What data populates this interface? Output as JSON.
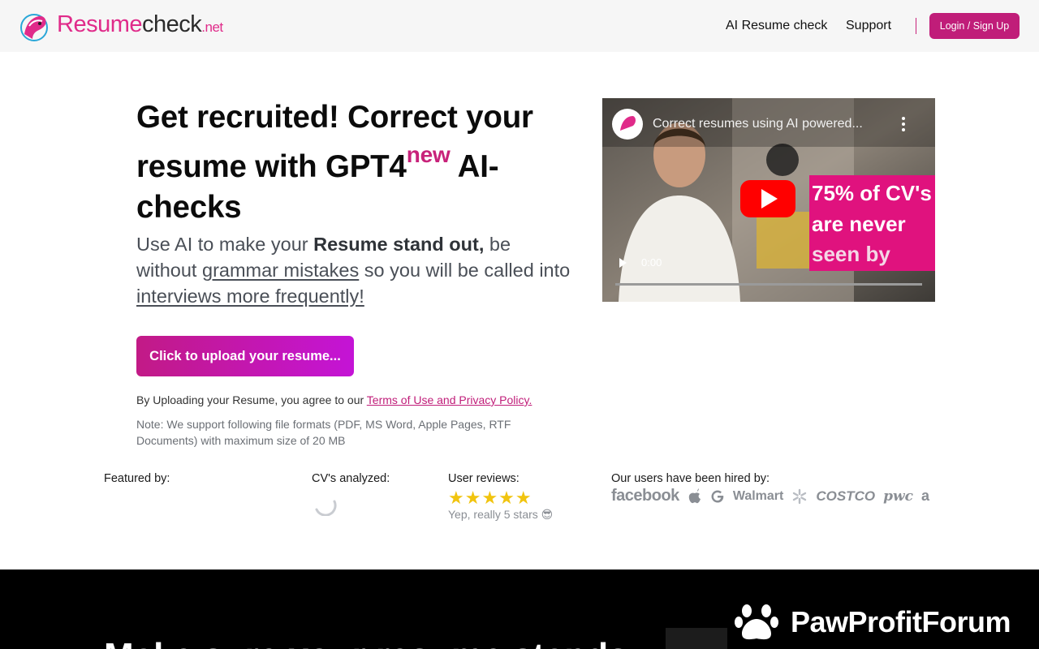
{
  "header": {
    "logo": {
      "part1": "Resume",
      "part2": "check",
      "part3": ".net"
    },
    "nav": {
      "ai_resume_check": "AI Resume check",
      "support": "Support"
    },
    "login_label": "Login / Sign Up"
  },
  "hero": {
    "headline_part1": "Get recruited! Correct your resume with GPT4",
    "headline_sup": "new",
    "headline_part2": " AI-checks",
    "sub_1": "Use AI to make your ",
    "sub_bold": "Resume stand out,",
    "sub_2": " be without ",
    "sub_link1": "grammar mistakes",
    "sub_3": " so you will be called into ",
    "sub_link2": "interviews more frequently!",
    "upload_label": "Click to upload your resume...",
    "agree_text": "By Uploading your Resume, you agree to our ",
    "agree_link": "Terms of Use and Privacy Policy.",
    "note": "Note: We support following file formats (PDF, MS Word, Apple Pages, RTF Documents) with maximum size of 20 MB"
  },
  "video": {
    "title": "Correct resumes using AI powered...",
    "time": "0:00",
    "overlay_line1": "75% of CV's",
    "overlay_line2": "are never",
    "overlay_line3": "seen by"
  },
  "stats": {
    "featured_label": "Featured by:",
    "analyzed_label": "CV's analyzed:",
    "reviews_label": "User reviews:",
    "stars": "★★★★★",
    "rating": 5,
    "reviews_text": "Yep, really 5 stars 😎",
    "hired_label": "Our users have been hired by:",
    "brands": [
      "facebook",
      "Walmart",
      "COSTCO",
      "pwc",
      "a"
    ]
  },
  "section2": {
    "title": "Make sure your resume stands"
  },
  "badge": {
    "text": "PawProfitForum"
  },
  "colors": {
    "brand": "#c01d79",
    "accent_pink": "#e02b8a",
    "star": "#f1c40f"
  }
}
